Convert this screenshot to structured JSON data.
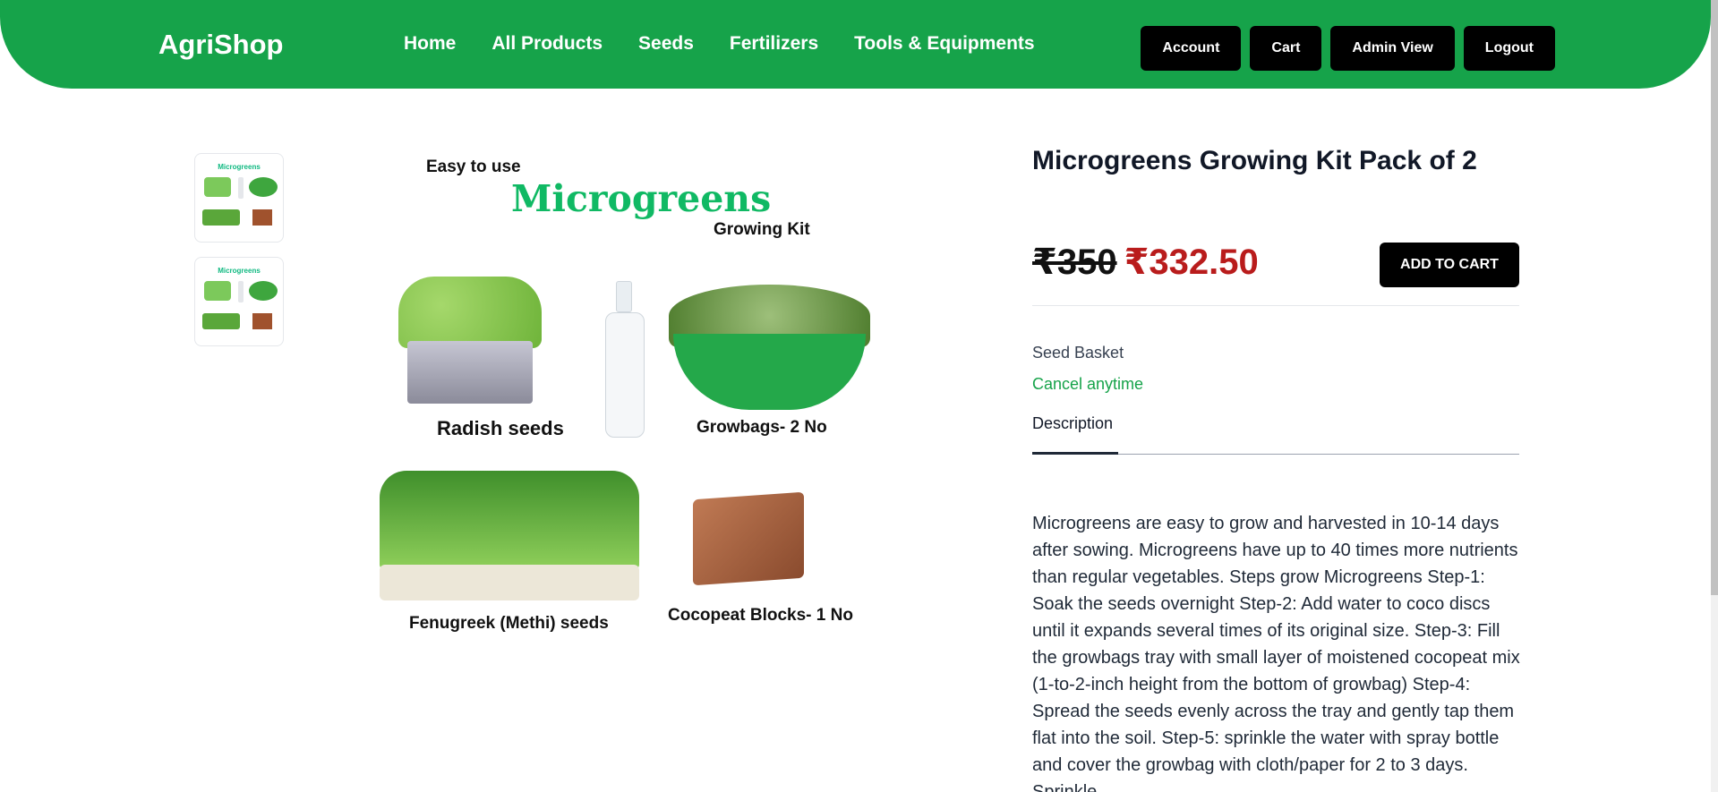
{
  "brand": "AgriShop",
  "nav": {
    "links": [
      "Home",
      "All Products",
      "Seeds",
      "Fertilizers",
      "Tools & Equipments"
    ],
    "buttons": [
      "Account",
      "Cart",
      "Admin View",
      "Logout"
    ]
  },
  "product_image": {
    "easy": "Easy to use",
    "title": "Microgreens",
    "subtitle": "Growing Kit",
    "radish": "Radish seeds",
    "growbags": "Growbags- 2 No",
    "fenugreek": "Fenugreek (Methi) seeds",
    "cocopeat": "Cocopeat Blocks- 1 No"
  },
  "product": {
    "title": "Microgreens Growing Kit Pack of 2",
    "old_price": "₹350",
    "new_price": "₹332.50",
    "add_to_cart": "ADD TO CART",
    "vendor": "Seed Basket",
    "cancel": "Cancel anytime",
    "tab": "Description",
    "description": "Microgreens are easy to grow and harvested in 10-14 days after sowing. Microgreens have up to 40 times more nutrients than regular vegetables. Steps grow Microgreens Step-1: Soak the seeds overnight Step-2: Add water to coco discs until it expands several times of its original size. Step-3: Fill the growbags tray with small layer of moistened cocopeat mix (1-to-2-inch height from the bottom of growbag) Step-4: Spread the seeds evenly across the tray and gently tap them flat into the soil. Step-5: sprinkle the water with spray bottle and cover the growbag with cloth/paper for 2 to 3 days. Sprinkle"
  },
  "colors": {
    "brand_green": "#16a34a",
    "price_red": "#b91c1c",
    "button_black": "#000000"
  }
}
